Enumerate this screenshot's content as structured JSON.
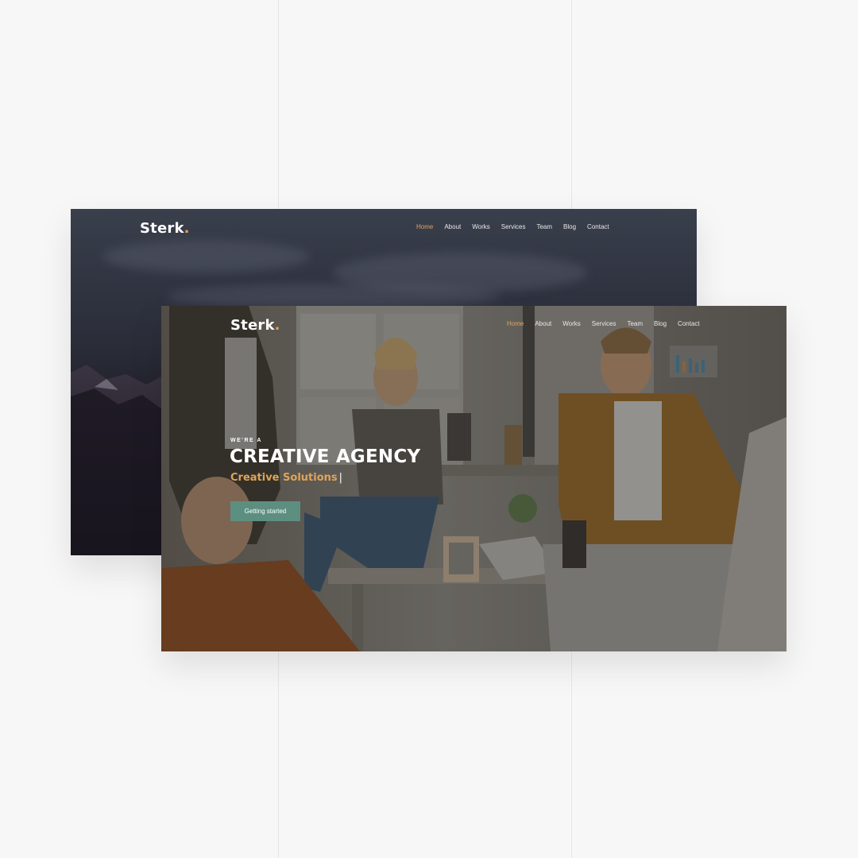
{
  "back_screen": {
    "logo": {
      "text": "Sterk",
      "dot": "."
    },
    "nav": [
      "Home",
      "About",
      "Works",
      "Services",
      "Team",
      "Blog",
      "Contact"
    ],
    "active_nav": "Home"
  },
  "front_screen": {
    "logo": {
      "text": "Sterk",
      "dot": "."
    },
    "nav": [
      "Home",
      "About",
      "Works",
      "Services",
      "Team",
      "Blog",
      "Contact"
    ],
    "active_nav": "Home",
    "hero": {
      "kicker": "WE'RE A",
      "headline": "CREATIVE AGENCY",
      "subline": "Creative Solutions",
      "caret": "|",
      "cta_label": "Getting started"
    }
  },
  "colors": {
    "accent": "#e0a458",
    "button": "#5d8f80",
    "page_bg": "#f7f7f7"
  }
}
